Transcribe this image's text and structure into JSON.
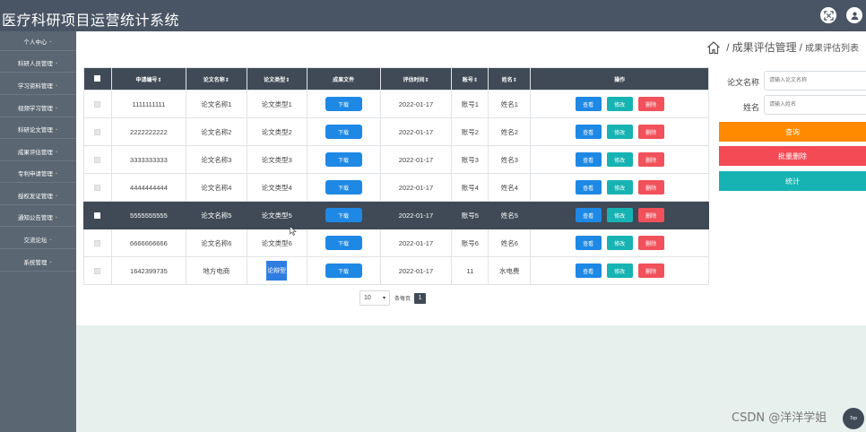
{
  "header": {
    "title": "医疗科研项目运营统计系统"
  },
  "sidebar": {
    "items": [
      {
        "label": "个人中心",
        "has_arrow": true
      },
      {
        "label": "科研人员管理",
        "has_arrow": true
      },
      {
        "label": "学习资料管理",
        "has_arrow": true
      },
      {
        "label": "视频学习管理",
        "has_arrow": true
      },
      {
        "label": "科研论文管理",
        "has_arrow": true
      },
      {
        "label": "成果评估管理",
        "has_arrow": true
      },
      {
        "label": "专利申请管理",
        "has_arrow": true
      },
      {
        "label": "授权发证管理",
        "has_arrow": true
      },
      {
        "label": "通知公告管理",
        "has_arrow": true
      },
      {
        "label": "交流论坛",
        "has_arrow": true
      },
      {
        "label": "系统管理",
        "has_arrow": true
      }
    ]
  },
  "breadcrumb": {
    "separator": "/",
    "main": "成果评估管理",
    "sub": "成果评估列表"
  },
  "table": {
    "headers": [
      "申请编号⇕",
      "论文名称⇕",
      "论文类型⇕",
      "成果文件",
      "评估时间⇕",
      "账号⇕",
      "姓名⇕",
      "操作"
    ],
    "rows": [
      {
        "id": "1111111111",
        "name": "论文名称1",
        "type": "论文类型1",
        "date": "2022-01-17",
        "account": "账号1",
        "person": "姓名1"
      },
      {
        "id": "2222222222",
        "name": "论文名称2",
        "type": "论文类型2",
        "date": "2022-01-17",
        "account": "账号2",
        "person": "姓名2"
      },
      {
        "id": "3333333333",
        "name": "论文名称3",
        "type": "论文类型3",
        "date": "2022-01-17",
        "account": "账号3",
        "person": "姓名3"
      },
      {
        "id": "4444444444",
        "name": "论文名称4",
        "type": "论文类型4",
        "date": "2022-01-17",
        "account": "账号4",
        "person": "姓名4"
      },
      {
        "id": "5555555555",
        "name": "论文名称5",
        "type": "论文类型5",
        "date": "2022-01-17",
        "account": "账号5",
        "person": "姓名5"
      },
      {
        "id": "6666666666",
        "name": "论文名称6",
        "type": "论文类型6",
        "date": "2022-01-17",
        "account": "账号6",
        "person": "姓名6"
      },
      {
        "id": "1642399735",
        "name": "地方电商",
        "type": "论辩型",
        "date": "2022-01-17",
        "account": "11",
        "person": "水电费"
      }
    ],
    "download_label": "下载",
    "view_label": "查看",
    "edit_label": "修改",
    "delete_label": "删除"
  },
  "pagination": {
    "page_size": "10",
    "per_page_label": "条每页",
    "current_page": "1"
  },
  "search": {
    "paper_name_label": "论文名称",
    "paper_name_placeholder": "请输入论文名称",
    "person_label": "姓名",
    "person_placeholder": "请输入姓名",
    "query_label": "查询",
    "batch_delete_label": "批量删除",
    "stats_label": "统计"
  },
  "colors": {
    "header_bg": "#495564",
    "sidebar_bg": "#5a6773",
    "table_header_bg": "#3f4a56",
    "primary": "#1e88e5",
    "edit": "#17b3b3",
    "delete": "#f1515a",
    "query": "#ff8a00",
    "batch_delete": "#f44a55",
    "stats": "#17b3b3"
  },
  "watermark": "CSDN @洋洋学姐",
  "back_to_top_label": "Top"
}
